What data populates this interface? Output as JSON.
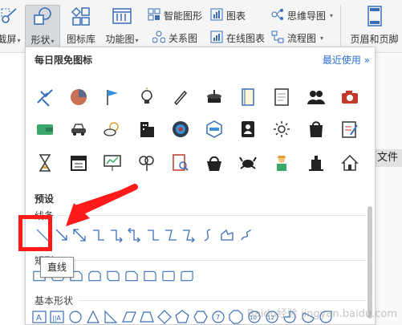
{
  "ribbon": {
    "screenshot_label": "截屏",
    "shapes_label": "形状",
    "icon_lib_label": "图标库",
    "func_chart_label": "功能图",
    "smart_graphic_label": "智能图形",
    "relation_label": "关系图",
    "chart_label": "图表",
    "online_chart_label": "在线图表",
    "mindmap_label": "思维导图",
    "flowchart_label": "流程图",
    "header_footer_label": "页眉和页脚"
  },
  "doc": {
    "side_text": "文件"
  },
  "panel": {
    "daily_title": "每日限免图标",
    "recent_label": "最近使用 »",
    "preset_title": "预设",
    "lines_label": "线条",
    "rect_label": "矩形",
    "basic_label": "基本形状",
    "tooltip": "直线",
    "icons_row1": [
      "airplane-icon",
      "pie-chart-icon",
      "flag-icon",
      "lightbulb-icon",
      "pen-icon",
      "cake-icon",
      "notebook-icon",
      "document-icon",
      "users-icon",
      "camera-icon"
    ],
    "icons_row2": [
      "wallet-icon",
      "car-icon",
      "weather-icon",
      "building-icon",
      "target-icon",
      "hexagon-badge-icon",
      "contact-card-icon",
      "sun-icon",
      "shopping-bag-icon",
      "edit-note-icon"
    ],
    "icons_row3": [
      "hourglass-icon",
      "sale-sign-icon",
      "presentation-icon",
      "tree-icon",
      "search-doc-icon",
      "basket-icon",
      "crab-icon",
      "worker-icon",
      "grave-icon",
      "house-icon"
    ],
    "basic_text_shapes": [
      "A",
      "||A"
    ]
  },
  "watermark": "Baidu经验 jingyan.baidu.com",
  "colors": {
    "highlight": "#ff1a1a",
    "accent": "#2b6fd6"
  }
}
